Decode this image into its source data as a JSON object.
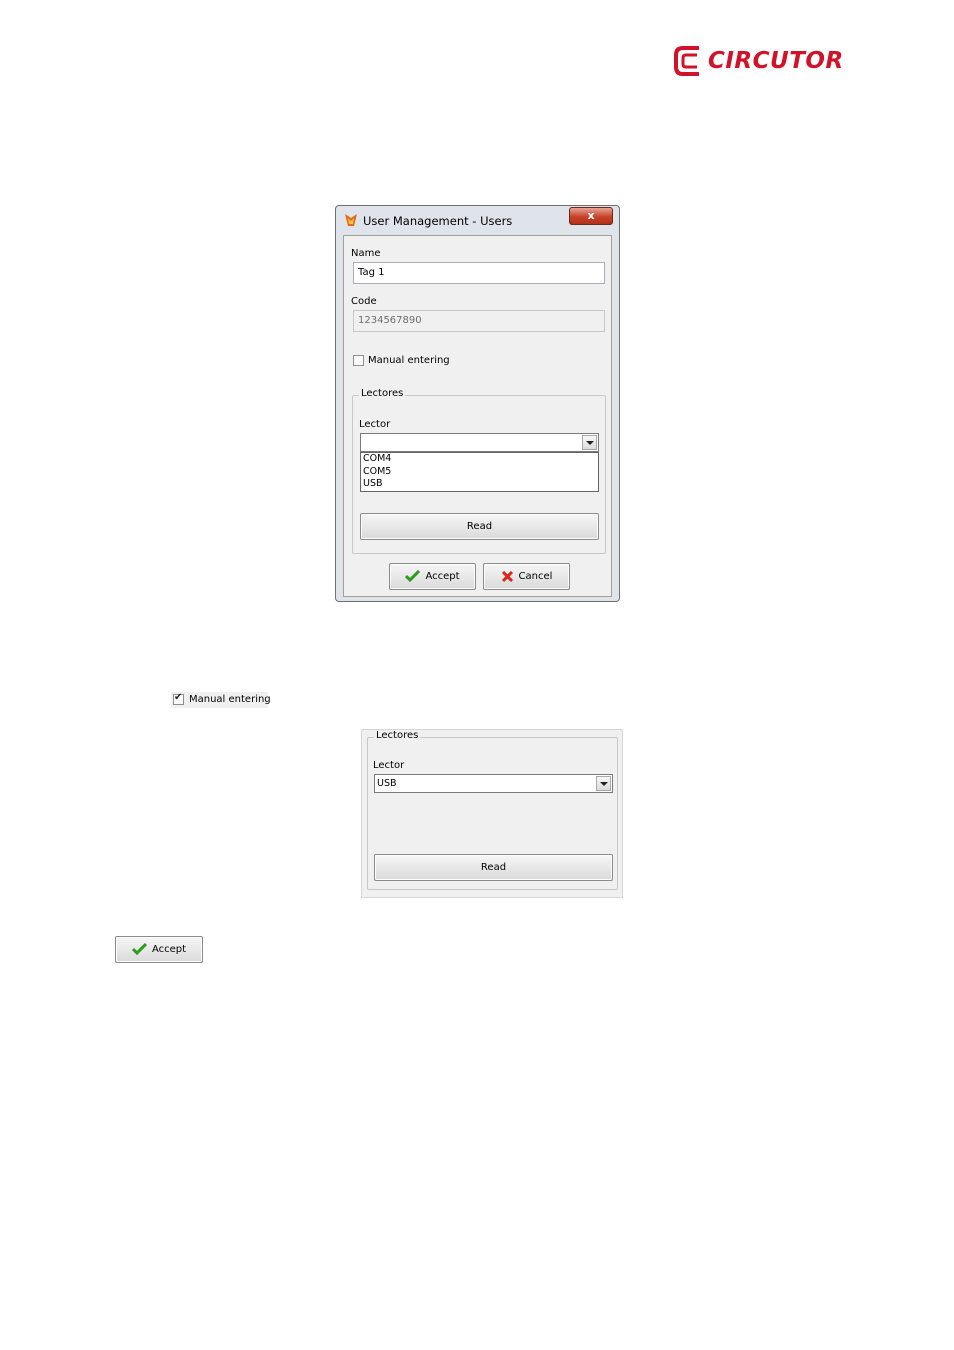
{
  "brand": {
    "name": "CIRCUTOR",
    "color": "#d0132a"
  },
  "dialog": {
    "title": "User Management - Users",
    "close_label": "x",
    "name_label": "Name",
    "name_value": "Tag 1",
    "code_label": "Code",
    "code_value": "1234567890",
    "manual_entering_label": "Manual entering",
    "manual_entering_checked": false,
    "group_title": "Lectores",
    "lector_label": "Lector",
    "lector_value": "",
    "lector_options": [
      "COM4",
      "COM5",
      "USB"
    ],
    "read_label": "Read",
    "accept_label": "Accept",
    "cancel_label": "Cancel"
  },
  "standalone_checkbox": {
    "label": "Manual entering",
    "checked": true
  },
  "panel2": {
    "group_title": "Lectores",
    "lector_label": "Lector",
    "lector_value": "USB",
    "read_label": "Read"
  },
  "standalone_accept": {
    "label": "Accept"
  }
}
